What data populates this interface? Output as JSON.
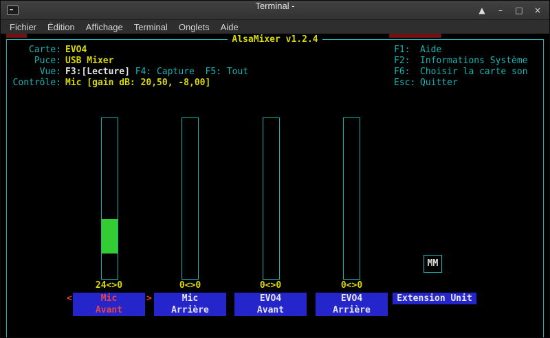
{
  "window": {
    "title": "Terminal -",
    "icons": {
      "rollup": "▲",
      "minimize": "–",
      "maximize": "□",
      "close": "×"
    }
  },
  "menu": {
    "items": [
      "Fichier",
      "Édition",
      "Affichage",
      "Terminal",
      "Onglets",
      "Aide"
    ]
  },
  "mixer": {
    "title": "AlsaMixer v1.2.4",
    "card_label": "Carte:",
    "card_value": "EVO4",
    "chip_label": "Puce:",
    "chip_value": "USB Mixer",
    "view_label": "Vue:",
    "view_active": "F3:[Lecture]",
    "view_rest": " F4: Capture  F5: Tout",
    "item_label": "Contrôle:",
    "item_value": "Mic [gain dB: 20,50, -8,00]",
    "help": [
      {
        "key": "F1:",
        "text": "Aide"
      },
      {
        "key": "F2:",
        "text": "Informations Système"
      },
      {
        "key": "F6:",
        "text": "Choisir la carte son"
      },
      {
        "key": "Esc:",
        "text": "Quitter"
      }
    ],
    "selection": {
      "left_marker": "<",
      "right_marker": ">"
    },
    "channels": [
      {
        "line1": "Mic",
        "line2": "Avant",
        "value": "24<>0",
        "selected": true,
        "fill": {
          "bottom_pct": 16,
          "height_pct": 21
        }
      },
      {
        "line1": "Mic",
        "line2": "Arrière",
        "value": "0<>0",
        "selected": false,
        "fill": {
          "bottom_pct": 0,
          "height_pct": 0
        }
      },
      {
        "line1": "EVO4",
        "line2": "Avant",
        "value": "0<>0",
        "selected": false,
        "fill": {
          "bottom_pct": 0,
          "height_pct": 0
        }
      },
      {
        "line1": "EVO4",
        "line2": "Arrière",
        "value": "0<>0",
        "selected": false,
        "fill": {
          "bottom_pct": 0,
          "height_pct": 0
        }
      },
      {
        "line1": "Extension Unit",
        "line2": "",
        "value": "",
        "selected": false,
        "mute": "MM"
      }
    ]
  },
  "colors": {
    "cyan": "#17b4b4",
    "yellow": "#d9d900",
    "green": "#33cc33",
    "blue_bg": "#2525cc",
    "red": "#e64545",
    "terminal_bg": "#000000"
  }
}
